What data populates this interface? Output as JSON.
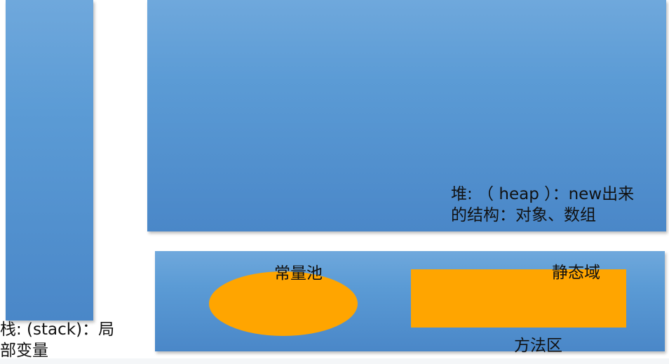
{
  "diagram": {
    "stack": {
      "label_line1": "栈: (stack)：局",
      "label_line2": "部变量"
    },
    "heap": {
      "label_line1": "堆: （ heap ）：new出来",
      "label_line2": "的结构：对象、数组"
    },
    "method_area": {
      "label": "方法区",
      "constant_pool_label": "常量池",
      "static_field_label": "静态域"
    },
    "colors": {
      "block_blue": "#5b9bd5",
      "block_blue_light": "#6fa8dc",
      "block_blue_dark": "#4a87c8",
      "orange": "#ffa500",
      "text": "#111111"
    }
  }
}
